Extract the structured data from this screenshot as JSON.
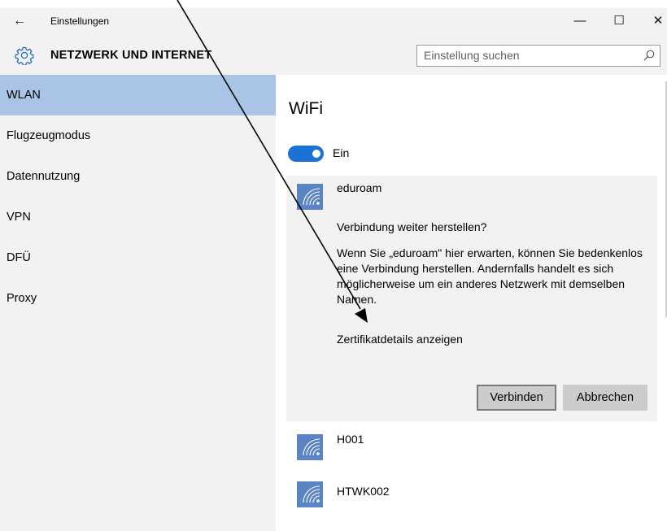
{
  "titlebar": {
    "back_glyph": "←",
    "title": "Einstellungen",
    "minimize_glyph": "—",
    "maximize_glyph": "☐",
    "close_glyph": "✕"
  },
  "header": {
    "icon": "gear-icon",
    "heading": "NETZWERK UND INTERNET",
    "search_placeholder": "Einstellung suchen",
    "search_icon": "search-icon"
  },
  "sidebar": {
    "items": [
      {
        "label": "WLAN",
        "active": true
      },
      {
        "label": "Flugzeugmodus",
        "active": false
      },
      {
        "label": "Datennutzung",
        "active": false
      },
      {
        "label": "VPN",
        "active": false
      },
      {
        "label": "DFÜ",
        "active": false
      },
      {
        "label": "Proxy",
        "active": false
      }
    ]
  },
  "content": {
    "title": "WiFi",
    "toggle_state": "Ein",
    "toggle_on": true,
    "expanded_network": {
      "name": "eduroam",
      "question": "Verbindung weiter herstellen?",
      "text": "Wenn Sie „eduroam\" hier erwarten, können Sie bedenkenlos eine Verbindung herstellen. Andernfalls handelt es sich möglicherweise um ein anderes Netzwerk mit demselben Namen.",
      "link": "Zertifikatdetails anzeigen",
      "connect_button": "Verbinden",
      "cancel_button": "Abbrechen"
    },
    "networks": [
      {
        "name": "H001"
      },
      {
        "name": "HTWK002"
      }
    ]
  },
  "colors": {
    "accent": "#1a73d4",
    "nav_active": "#aac4e6",
    "panel_bg": "#f2f2f2",
    "wifi_tile": "#5b84c4"
  }
}
